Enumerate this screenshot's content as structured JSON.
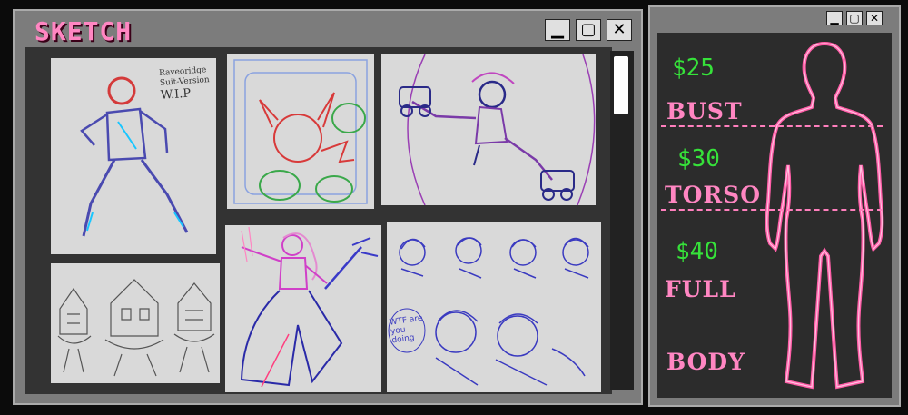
{
  "sketch_window": {
    "title": "SKETCH",
    "minimize": "▁",
    "maximize": "▢",
    "close": "✕",
    "sketches": [
      {
        "name": "armored-figure-sketch",
        "caption_line1": "Raveoridge",
        "caption_line2": "Suit-Version",
        "caption_line3": "W.I.P"
      },
      {
        "name": "electric-creature-sketch"
      },
      {
        "name": "roller-skater-sketch"
      },
      {
        "name": "floating-houses-sketch"
      },
      {
        "name": "magical-girl-sketch"
      },
      {
        "name": "expressions-sketch",
        "speech": "WTF are you doing"
      }
    ]
  },
  "price_window": {
    "minimize": "▁",
    "maximize": "▢",
    "close": "✕",
    "tiers": [
      {
        "price": "$25",
        "label": "BUST"
      },
      {
        "price": "$30",
        "label": "TORSO"
      },
      {
        "price": "$40",
        "label": "FULL"
      },
      {
        "label": "BODY"
      }
    ]
  },
  "colors": {
    "pink": "#ff86c2",
    "green": "#36e23a",
    "window_gray": "#7c7c7c"
  }
}
